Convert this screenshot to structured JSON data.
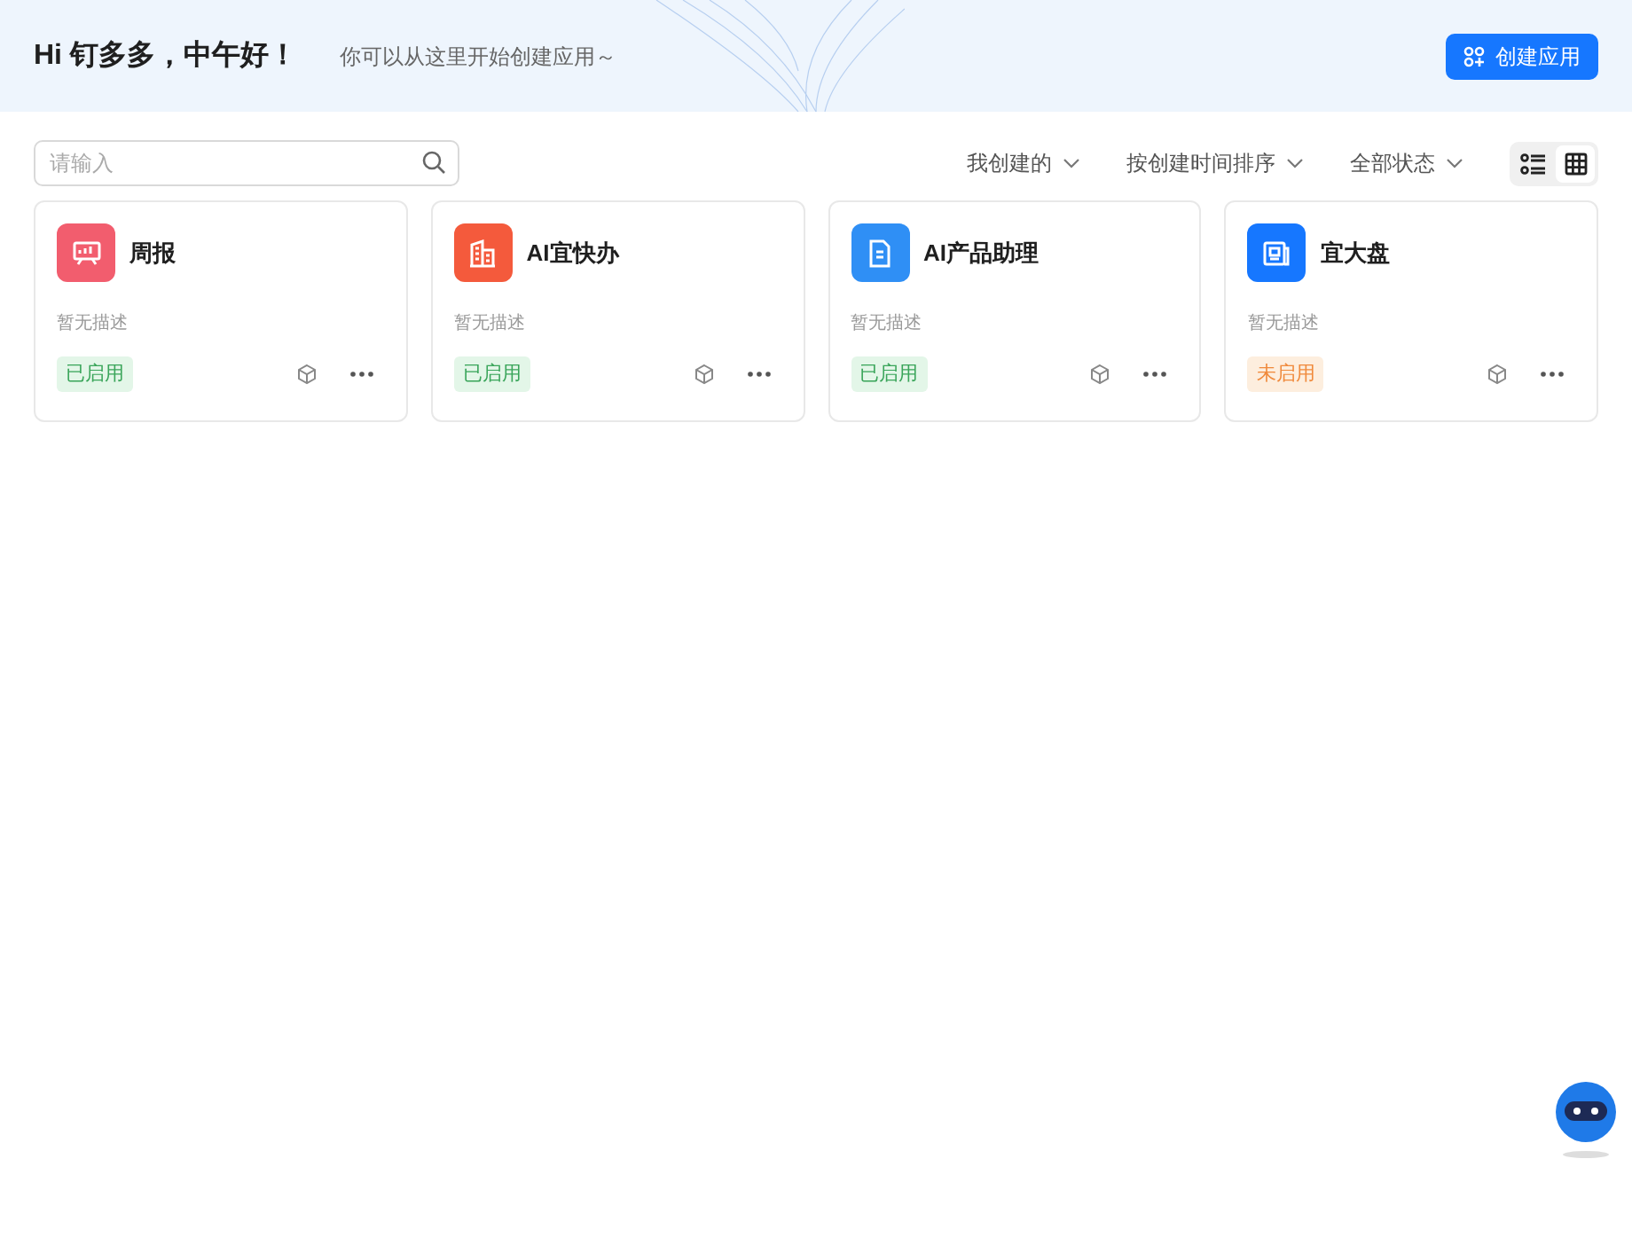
{
  "header": {
    "greeting": "Hi 钉多多，中午好！",
    "subtitle": "你可以从这里开始创建应用～",
    "create_button": "创建应用"
  },
  "toolbar": {
    "search": {
      "placeholder": "请输入"
    },
    "filters": [
      "我创建的",
      "按创建时间排序",
      "全部状态"
    ],
    "views": [
      {
        "kind": "list",
        "selected": false
      },
      {
        "kind": "grid",
        "selected": true
      }
    ]
  },
  "apps": [
    {
      "name": "周报",
      "description": "暂无描述",
      "status": "已启用",
      "enabled": true,
      "kind": "board",
      "color": "#f25d6e"
    },
    {
      "name": "AI宜快办",
      "description": "暂无描述",
      "status": "已启用",
      "enabled": true,
      "kind": "building",
      "color": "#f45a3c"
    },
    {
      "name": "AI产品助理",
      "description": "暂无描述",
      "status": "已启用",
      "enabled": true,
      "kind": "document",
      "color": "#2f8ff5"
    },
    {
      "name": "宜大盘",
      "description": "暂无描述",
      "status": "未启用",
      "enabled": false,
      "kind": "newspaper",
      "color": "#1677ff"
    }
  ]
}
